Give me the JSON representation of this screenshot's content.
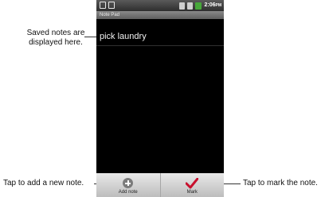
{
  "callouts": {
    "saved_notes": "Saved notes are displayed here.",
    "add_note": "Tap to add a new note.",
    "mark_note": "Tap to mark the note."
  },
  "statusbar": {
    "time": "2:06",
    "time_suffix": "PM",
    "icons": [
      "notification-icon",
      "notification-icon",
      "sd-icon",
      "signal-icon",
      "battery-icon"
    ]
  },
  "app": {
    "title": "Note Pad",
    "notes": [
      "pick laundry"
    ]
  },
  "bottombar": {
    "add_label": "Add note",
    "mark_label": "Mark",
    "add_icon": "plus-circle-icon",
    "mark_icon": "checkmark-icon",
    "mark_color": "#c8102e"
  }
}
